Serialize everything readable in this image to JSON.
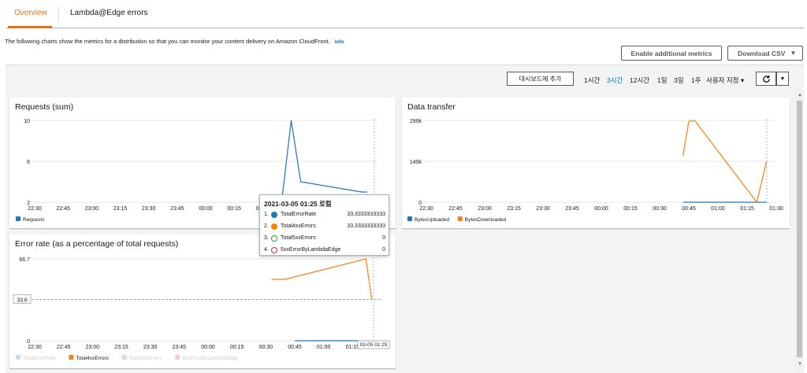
{
  "tabs": [
    "Overview",
    "Lambda@Edge errors"
  ],
  "description": "The following charts show the metrics for a distribution so that you can monitor your content delivery on Amazon CloudFront.",
  "info_link": "Info",
  "buttons": {
    "enable_metrics": "Enable additional metrics",
    "download_csv": "Download CSV"
  },
  "toolbar": {
    "add_to_dashboard": "대시보드에 추가",
    "ranges": [
      "1시간",
      "3시간",
      "12시간",
      "1일",
      "3일",
      "1주",
      "사용자 지정"
    ],
    "selected_range": "3시간"
  },
  "x_ticks": [
    "22:30",
    "22:45",
    "23:00",
    "23:15",
    "23:30",
    "23:45",
    "00:00",
    "00:15",
    "00:30",
    "00:45",
    "01:00",
    "01:15",
    "01:30"
  ],
  "colors": {
    "blue": "#1f77b4",
    "orange": "#ff7f0e",
    "green": "#2ca02c",
    "red": "#d62728",
    "accent": "#ec7211"
  },
  "chart_data": [
    {
      "type": "line",
      "title": "Requests (sum)",
      "ylim": [
        2,
        10
      ],
      "y_ticks": [
        "10",
        "6",
        "2"
      ],
      "series": [
        {
          "name": "Requests",
          "color": "#1f77b4",
          "points": [
            [
              "00:40",
              2
            ],
            [
              "00:45",
              10
            ],
            [
              "00:50",
              4
            ],
            [
              "01:22",
              3
            ],
            [
              "01:25",
              3
            ]
          ]
        }
      ]
    },
    {
      "type": "line",
      "title": "Data transfer",
      "ylim": [
        0,
        299000
      ],
      "y_ticks": [
        "299k",
        "149k",
        "0"
      ],
      "series": [
        {
          "name": "BytesUploaded",
          "color": "#1f77b4",
          "points": [
            [
              "00:42",
              0
            ],
            [
              "00:47",
              0
            ],
            [
              "01:22",
              0
            ],
            [
              "01:25",
              0
            ]
          ]
        },
        {
          "name": "BytesDownloaded",
          "color": "#ff7f0e",
          "points": [
            [
              "00:42",
              170000
            ],
            [
              "00:45",
              295000
            ],
            [
              "00:48",
              299000
            ],
            [
              "01:20",
              0
            ],
            [
              "01:25",
              149000
            ]
          ]
        }
      ]
    },
    {
      "type": "line",
      "title": "Error rate (as a percentage of total requests)",
      "ylim": [
        0,
        66.7
      ],
      "y_ticks": [
        "66.7",
        "0"
      ],
      "threshold_label": "33.6",
      "cursor_label": "03-05 01:25",
      "series": [
        {
          "name": "TotalErrorRate",
          "color": "#1f77b4",
          "points": [
            [
              "00:45",
              0
            ],
            [
              "01:25",
              0
            ]
          ]
        },
        {
          "name": "Total4xxErrors",
          "color": "#ff7f0e",
          "points": [
            [
              "00:33",
              50
            ],
            [
              "00:40",
              50
            ],
            [
              "01:22",
              66.7
            ],
            [
              "01:25",
              33.3
            ]
          ]
        },
        {
          "name": "Total5xxErrors",
          "color": "#2ca02c",
          "points": []
        },
        {
          "name": "5xxErrorByLambdaEdge",
          "color": "#d62728",
          "points": []
        }
      ]
    }
  ],
  "tooltip": {
    "title": "2021-03-05 01:25 로컬",
    "rows": [
      {
        "n": "1.",
        "label": "TotalErrorRate",
        "value": "33.3333333333",
        "color": "#1f77b4",
        "hollow": false
      },
      {
        "n": "2.",
        "label": "Total4xxErrors",
        "value": "33.3333333333",
        "color": "#ff7f0e",
        "hollow": false
      },
      {
        "n": "3.",
        "label": "Total5xxErrors",
        "value": "0",
        "color": "#2ca02c",
        "hollow": true
      },
      {
        "n": "4.",
        "label": "5xxErrorByLambdaEdge",
        "value": "0",
        "color": "#d62728",
        "hollow": true
      }
    ]
  }
}
